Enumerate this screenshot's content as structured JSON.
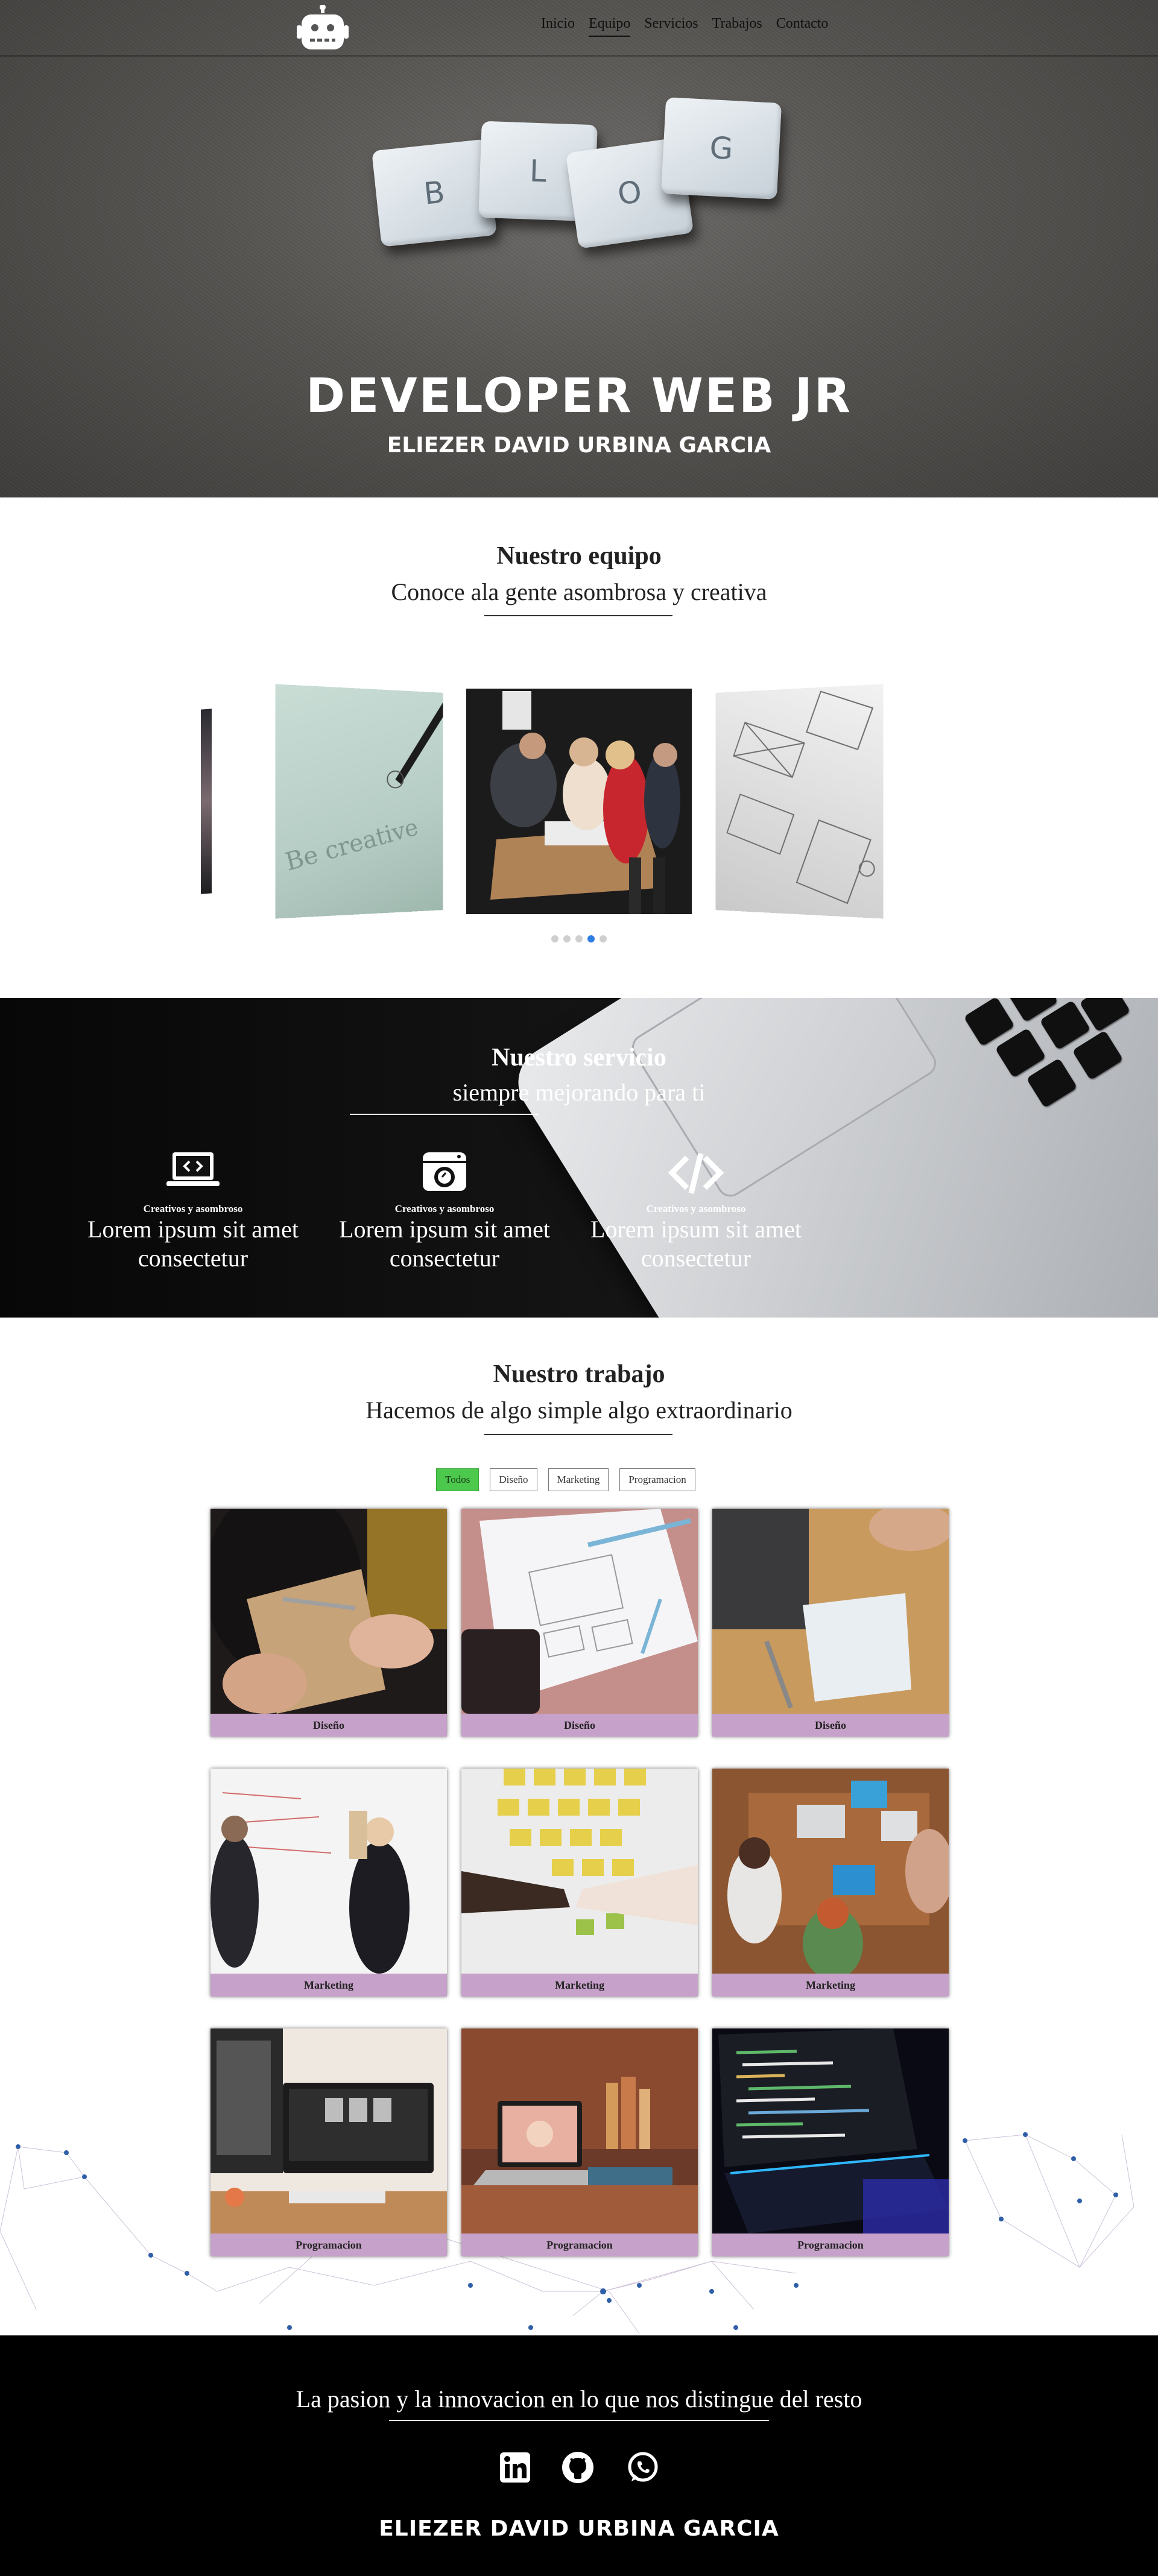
{
  "nav": {
    "logo_icon": "robot-icon",
    "items": [
      {
        "label": "Inicio"
      },
      {
        "label": "Equipo"
      },
      {
        "label": "Servicios"
      },
      {
        "label": "Trabajos"
      },
      {
        "label": "Contacto"
      }
    ],
    "active": "Equipo"
  },
  "hero": {
    "tiles": [
      "B",
      "L",
      "O",
      "G"
    ],
    "title": "DEVELOPER WEB JR",
    "subtitle": "ELIEZER DAVID URBINA GARCIA"
  },
  "team": {
    "title": "Nuestro equipo",
    "subtitle": "Conoce ala gente asombrosa y creativa",
    "slide_words": "Be creative",
    "dots": 5,
    "active_dot": 4
  },
  "services": {
    "title": "Nuestro servicio",
    "subtitle": "siempre mejorando para ti",
    "items": [
      {
        "icon": "laptop-code-icon",
        "small": "Creativos y asombroso",
        "text": "Lorem ipsum sit amet consectetur"
      },
      {
        "icon": "camera-icon",
        "small": "Creativos y asombroso",
        "text": "Lorem ipsum sit amet consectetur"
      },
      {
        "icon": "code-icon",
        "small": "Creativos y asombroso",
        "text": "Lorem ipsum sit amet consectetur"
      }
    ]
  },
  "work": {
    "title": "Nuestro trabajo",
    "subtitle": "Hacemos de algo simple algo extraordinario",
    "filters": [
      "Todos",
      "Diseño",
      "Marketing",
      "Programacion"
    ],
    "active_filter": "Todos",
    "cards": [
      {
        "label": "Diseño"
      },
      {
        "label": "Diseño"
      },
      {
        "label": "Diseño"
      },
      {
        "label": "Marketing"
      },
      {
        "label": "Marketing"
      },
      {
        "label": "Marketing"
      },
      {
        "label": "Programacion"
      },
      {
        "label": "Programacion"
      },
      {
        "label": "Programacion"
      }
    ],
    "label_color": "#c6a1c9",
    "filter_active_color": "#4cc94c"
  },
  "footer": {
    "text": "La pasion y la innovacion en lo que nos distingue del resto",
    "social": [
      "linkedin-icon",
      "github-icon",
      "whatsapp-icon"
    ],
    "name": "ELIEZER DAVID URBINA GARCIA"
  }
}
